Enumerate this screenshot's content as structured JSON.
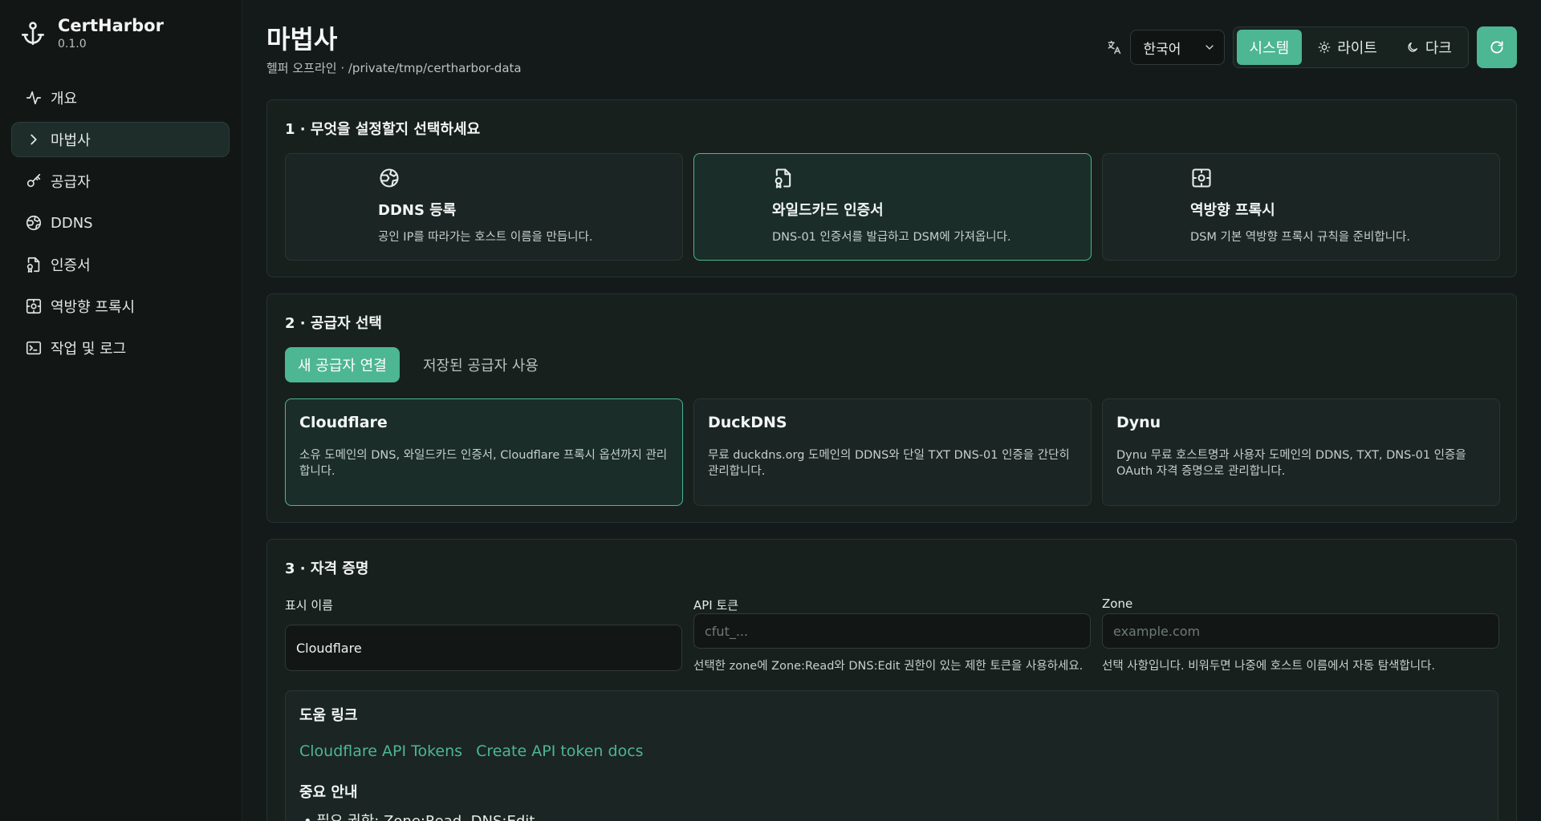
{
  "app": {
    "name": "CertHarbor",
    "version": "0.1.0"
  },
  "sidebar": {
    "items": [
      {
        "label": "개요",
        "icon": "activity-icon",
        "active": false
      },
      {
        "label": "마법사",
        "icon": "chevron-right-icon",
        "active": true
      },
      {
        "label": "공급자",
        "icon": "key-icon",
        "active": false
      },
      {
        "label": "DDNS",
        "icon": "globe-icon",
        "active": false
      },
      {
        "label": "인증서",
        "icon": "file-badge-icon",
        "active": false
      },
      {
        "label": "역방향 프록시",
        "icon": "router-icon",
        "active": false
      },
      {
        "label": "작업 및 로그",
        "icon": "terminal-icon",
        "active": false
      }
    ]
  },
  "header": {
    "title": "마법사",
    "subtitle": "헬퍼 오프라인 · /private/tmp/certharbor-data",
    "language": "한국어",
    "themes": [
      {
        "label": "시스템",
        "active": true
      },
      {
        "label": "라이트",
        "active": false
      },
      {
        "label": "다크",
        "active": false
      }
    ]
  },
  "step1": {
    "title": "1 · 무엇을 설정할지 선택하세요",
    "options": [
      {
        "title": "DDNS 등록",
        "desc": "공인 IP를 따라가는 호스트 이름을 만듭니다.",
        "icon": "globe-icon",
        "selected": false
      },
      {
        "title": "와일드카드 인증서",
        "desc": "DNS-01 인증서를 발급하고 DSM에 가져옵니다.",
        "icon": "file-badge-icon",
        "selected": true
      },
      {
        "title": "역방향 프록시",
        "desc": "DSM 기본 역방향 프록시 규칙을 준비합니다.",
        "icon": "router-icon",
        "selected": false
      }
    ]
  },
  "step2": {
    "title": "2 · 공급자 선택",
    "tab_new": "새 공급자 연결",
    "tab_saved": "저장된 공급자 사용",
    "providers": [
      {
        "name": "Cloudflare",
        "desc": "소유 도메인의 DNS, 와일드카드 인증서, Cloudflare 프록시 옵션까지 관리합니다.",
        "selected": true
      },
      {
        "name": "DuckDNS",
        "desc": "무료 duckdns.org 도메인의 DDNS와 단일 TXT DNS-01 인증을 간단히 관리합니다.",
        "selected": false
      },
      {
        "name": "Dynu",
        "desc": "Dynu 무료 호스트명과 사용자 도메인의 DDNS, TXT, DNS-01 인증을 OAuth 자격 증명으로 관리합니다.",
        "selected": false
      }
    ]
  },
  "step3": {
    "title": "3 · 자격 증명",
    "display_name": {
      "label": "표시 이름",
      "value": "Cloudflare"
    },
    "api_token": {
      "label": "API 토큰",
      "placeholder": "cfut_...",
      "hint": "선택한 zone에 Zone:Read와 DNS:Edit 권한이 있는 제한 토큰을 사용하세요."
    },
    "zone": {
      "label": "Zone",
      "placeholder": "example.com",
      "hint": "선택 사항입니다. 비워두면 나중에 호스트 이름에서 자동 탐색합니다."
    },
    "help": {
      "title": "도움 링크",
      "links": [
        "Cloudflare API Tokens",
        "Create API token docs"
      ],
      "notice_title": "중요 안내",
      "notice_items": [
        "필요 권한: Zone:Read, DNS:Edit."
      ]
    }
  },
  "colors": {
    "accent": "#4db693",
    "background": "#141a19",
    "card": "#18201e"
  }
}
